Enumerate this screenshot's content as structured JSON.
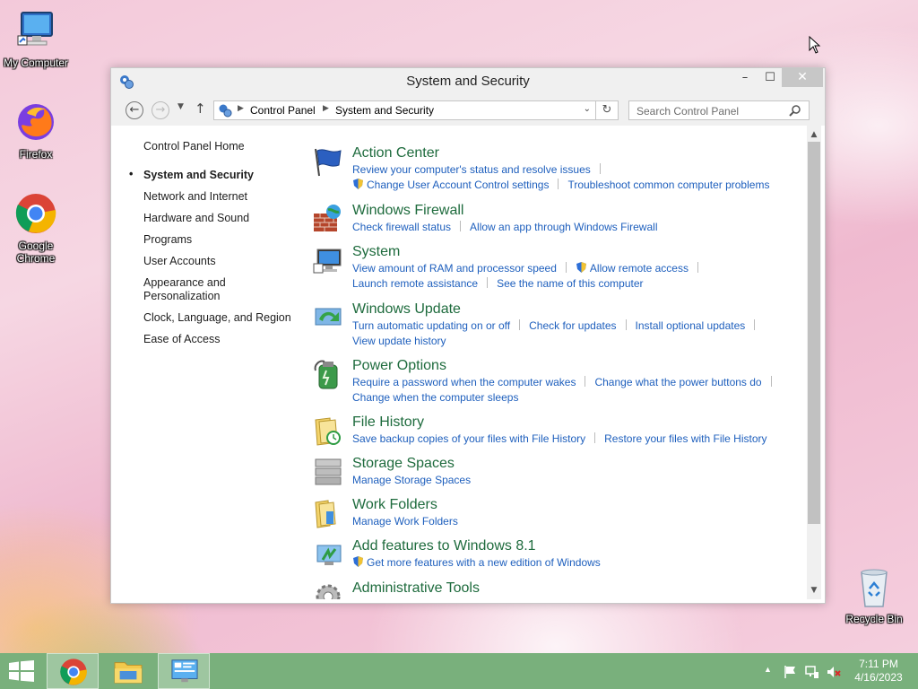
{
  "desktop": {
    "icons": [
      {
        "label": "My Computer",
        "icon": "computer-icon"
      },
      {
        "label": "Firefox",
        "icon": "firefox-icon"
      },
      {
        "label": "Google Chrome",
        "icon": "chrome-icon"
      },
      {
        "label": "Recycle Bin",
        "icon": "recycle-bin-icon"
      }
    ]
  },
  "window": {
    "title": "System and Security",
    "controls": {
      "minimize": "–",
      "maximize": "☐",
      "close": "✕"
    }
  },
  "toolbar": {
    "breadcrumbs": [
      "Control Panel",
      "System and Security"
    ],
    "search_placeholder": "Search Control Panel"
  },
  "sidebar": {
    "home": "Control Panel Home",
    "items": [
      {
        "label": "System and Security",
        "current": true
      },
      {
        "label": "Network and Internet"
      },
      {
        "label": "Hardware and Sound"
      },
      {
        "label": "Programs"
      },
      {
        "label": "User Accounts"
      },
      {
        "label": "Appearance and Personalization"
      },
      {
        "label": "Clock, Language, and Region"
      },
      {
        "label": "Ease of Access"
      }
    ]
  },
  "categories": [
    {
      "title": "Action Center",
      "icon": "flag-icon",
      "links": [
        "Review your computer's status and resolve issues",
        "Change User Account Control settings",
        "Troubleshoot common computer problems"
      ]
    },
    {
      "title": "Windows Firewall",
      "icon": "firewall-icon",
      "links": [
        "Check firewall status",
        "Allow an app through Windows Firewall"
      ]
    },
    {
      "title": "System",
      "icon": "system-icon",
      "links": [
        "View amount of RAM and processor speed",
        "Allow remote access",
        "Launch remote assistance",
        "See the name of this computer"
      ]
    },
    {
      "title": "Windows Update",
      "icon": "windows-update-icon",
      "links": [
        "Turn automatic updating on or off",
        "Check for updates",
        "Install optional updates",
        "View update history"
      ]
    },
    {
      "title": "Power Options",
      "icon": "power-options-icon",
      "links": [
        "Require a password when the computer wakes",
        "Change what the power buttons do",
        "Change when the computer sleeps"
      ]
    },
    {
      "title": "File History",
      "icon": "file-history-icon",
      "links": [
        "Save backup copies of your files with File History",
        "Restore your files with File History"
      ]
    },
    {
      "title": "Storage Spaces",
      "icon": "storage-spaces-icon",
      "links": [
        "Manage Storage Spaces"
      ]
    },
    {
      "title": "Work Folders",
      "icon": "work-folders-icon",
      "links": [
        "Manage Work Folders"
      ]
    },
    {
      "title": "Add features to Windows 8.1",
      "icon": "add-features-icon",
      "links": [
        "Get more features with a new edition of Windows"
      ]
    },
    {
      "title": "Administrative Tools",
      "icon": "admin-tools-icon",
      "links": []
    }
  ],
  "taskbar": {
    "time": "7:11 PM",
    "date": "4/16/2023"
  },
  "colors": {
    "category_title": "#1e6b3d",
    "link": "#1e5fbd",
    "taskbar": "#79b07c"
  }
}
